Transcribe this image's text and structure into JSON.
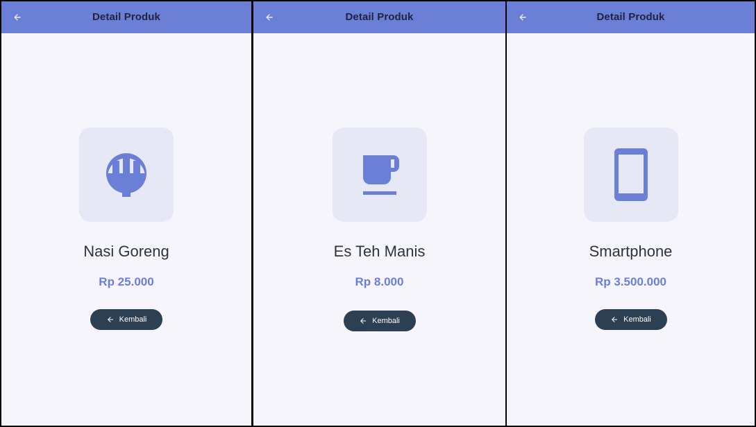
{
  "colors": {
    "appbar": "#6b7fd7",
    "background": "#f6f5fc",
    "icon_tile": "#e6e8f6",
    "icon": "#6b7fd7",
    "price": "#6b7fd7",
    "button": "#2d3f52",
    "title_text": "#1f2340"
  },
  "screens": [
    {
      "appbar_title": "Detail Produk",
      "icon": "rice-bowl-icon",
      "name": "Nasi Goreng",
      "price": "Rp 25.000",
      "button_label": "Kembali"
    },
    {
      "appbar_title": "Detail Produk",
      "icon": "coffee-cup-icon",
      "name": "Es Teh Manis",
      "price": "Rp 8.000",
      "button_label": "Kembali"
    },
    {
      "appbar_title": "Detail Produk",
      "icon": "smartphone-icon",
      "name": "Smartphone",
      "price": "Rp 3.500.000",
      "button_label": "Kembali"
    }
  ]
}
